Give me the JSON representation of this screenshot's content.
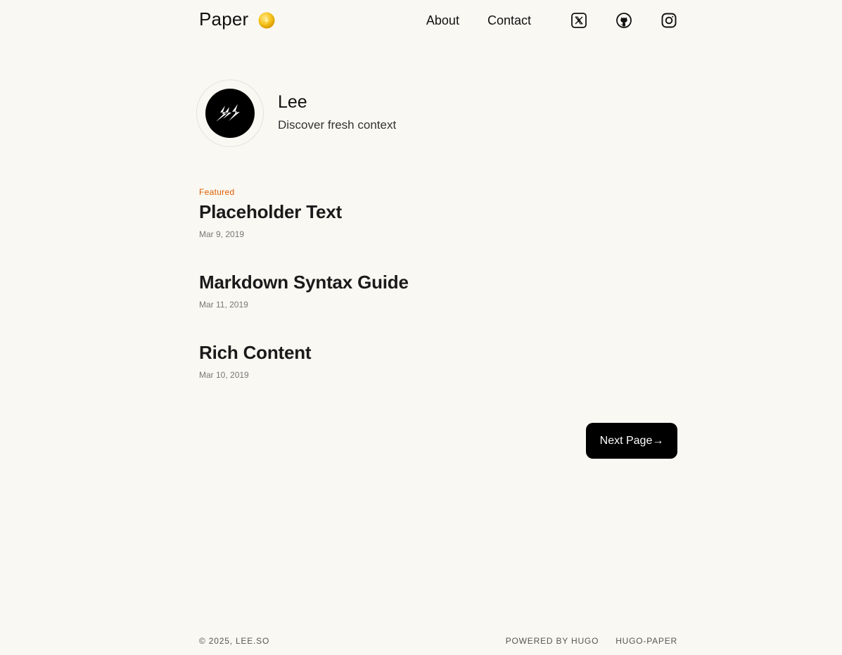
{
  "header": {
    "brand": "Paper",
    "nav": {
      "about": "About",
      "contact": "Contact"
    },
    "social_icons": [
      "x-twitter-icon",
      "github-icon",
      "instagram-icon"
    ]
  },
  "profile": {
    "name": "Lee",
    "bio": "Discover fresh context"
  },
  "posts": [
    {
      "featured": "Featured",
      "title": "Placeholder Text",
      "date": "Mar 9, 2019"
    },
    {
      "title": "Markdown Syntax Guide",
      "date": "Mar 11, 2019"
    },
    {
      "title": "Rich Content",
      "date": "Mar 10, 2019"
    }
  ],
  "pagination": {
    "next_label": "Next Page→"
  },
  "footer": {
    "copyright": "© 2025, LEE.SO",
    "powered": "POWERED BY HUGO",
    "theme": "HUGO-PAPER"
  },
  "colors": {
    "background": "#faf8f2",
    "accent_featured": "#e05c00",
    "button": "#000000"
  }
}
